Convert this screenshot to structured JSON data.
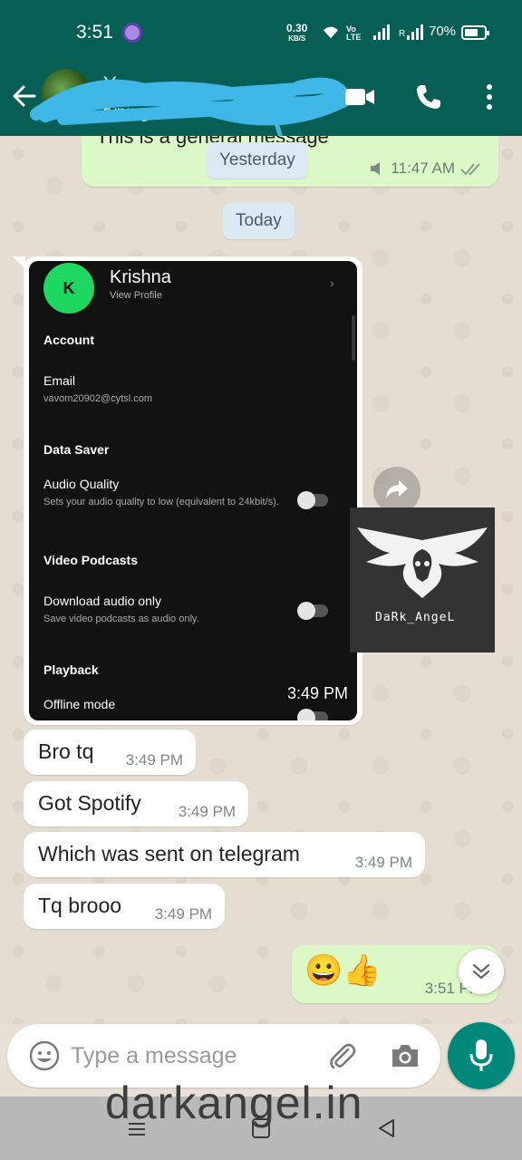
{
  "status_bar": {
    "time": "3:51",
    "net_speed_value": "0.30",
    "net_speed_unit": "KB/S",
    "volte_top": "Vo",
    "volte_bottom": "LTE",
    "sim2_label": "R",
    "battery_percent": "70%",
    "battery_level": 0.7
  },
  "header": {
    "contact_name": "Y",
    "status": "typing..."
  },
  "chat": {
    "previous_message": {
      "text": "This is a general message",
      "time": "11:47 AM"
    },
    "date_chips": {
      "yesterday": "Yesterday",
      "today": "Today"
    },
    "image_message": {
      "time": "3:49 PM",
      "screenshot": {
        "avatar_letter": "K",
        "profile_name": "Krishna",
        "view_profile": "View Profile",
        "account_heading": "Account",
        "email_label": "Email",
        "email_value": "vavom20902@cytsl.com",
        "data_saver_heading": "Data Saver",
        "audio_quality_label": "Audio Quality",
        "audio_quality_desc": "Sets your audio quality to low (equivalent to 24kbit/s).",
        "video_podcasts_heading": "Video Podcasts",
        "download_audio_label": "Download audio only",
        "download_audio_desc": "Save video podcasts as audio only.",
        "playback_heading": "Playback",
        "offline_mode_label": "Offline mode"
      }
    },
    "messages": [
      {
        "text": "Bro tq",
        "time": "3:49 PM"
      },
      {
        "text": "Got Spotify",
        "time": "3:49 PM"
      },
      {
        "text": "Which was sent on telegram",
        "time": "3:49 PM"
      },
      {
        "text": "Tq brooo",
        "time": "3:49 PM"
      }
    ],
    "outgoing_emoji": {
      "text": "😀👍",
      "time": "3:51 PM"
    },
    "watermark_logo_text": "DaRk_AngeL"
  },
  "input": {
    "placeholder": "Type a message"
  },
  "site_watermark": "darkangel.in",
  "colors": {
    "header": "#075e54",
    "outgoing_bubble": "#dcf8c6",
    "incoming_bubble": "#ffffff",
    "mic_button": "#00897b",
    "spotify_green": "#1ed760"
  },
  "icons": [
    "back-arrow-icon",
    "video-call-icon",
    "phone-icon",
    "more-vert-icon",
    "forward-icon",
    "double-chevron-down-icon",
    "emoji-icon",
    "paperclip-icon",
    "camera-icon",
    "mic-icon",
    "speaker-icon",
    "double-check-icon"
  ]
}
